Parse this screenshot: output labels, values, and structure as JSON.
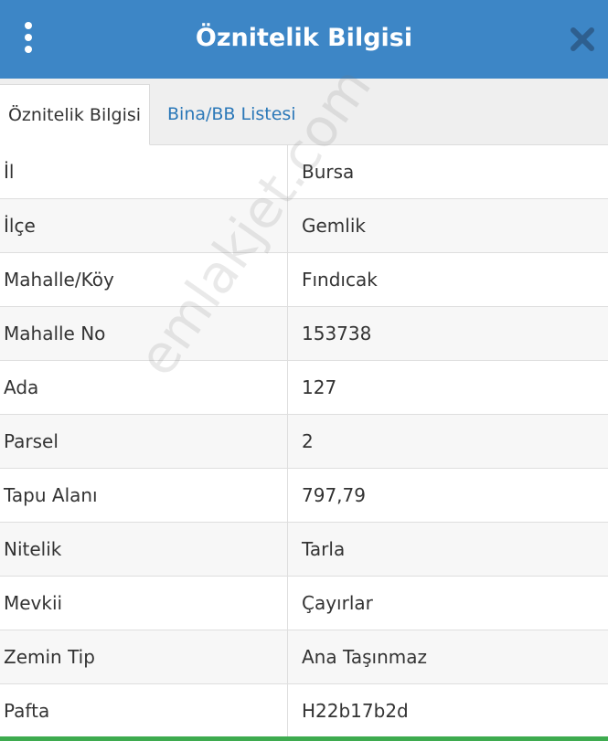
{
  "header": {
    "title": "Öznitelik Bilgisi",
    "menu_icon": "vertical-dots-icon",
    "close_icon": "close-icon",
    "background_color": "#3d86c6"
  },
  "tabs": [
    {
      "label": "Öznitelik Bilgisi",
      "active": true
    },
    {
      "label": "Bina/BB Listesi",
      "active": false
    }
  ],
  "rows": [
    {
      "label": "İl",
      "value": "Bursa"
    },
    {
      "label": "İlçe",
      "value": "Gemlik"
    },
    {
      "label": "Mahalle/Köy",
      "value": "Fındıcak"
    },
    {
      "label": "Mahalle No",
      "value": "153738"
    },
    {
      "label": "Ada",
      "value": "127"
    },
    {
      "label": "Parsel",
      "value": "2"
    },
    {
      "label": "Tapu Alanı",
      "value": "797,79"
    },
    {
      "label": "Nitelik",
      "value": "Tarla"
    },
    {
      "label": "Mevkii",
      "value": "Çayırlar"
    },
    {
      "label": "Zemin Tip",
      "value": "Ana Taşınmaz"
    },
    {
      "label": "Pafta",
      "value": "H22b17b2d"
    }
  ],
  "watermark": "emlakjet.com"
}
